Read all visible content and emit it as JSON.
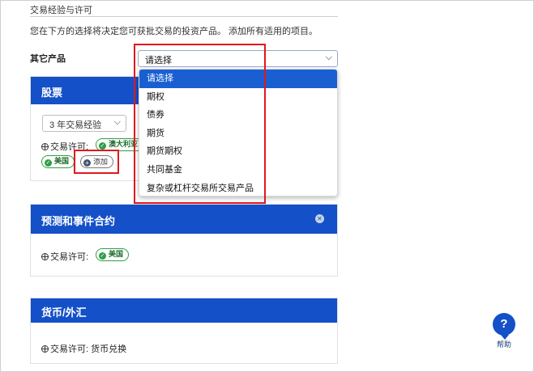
{
  "section": {
    "title": "交易经验与许可",
    "intro": "您在下方的选择将决定您可获批交易的投资产品。 添加所有适用的项目。"
  },
  "other_products": {
    "label": "其它产品",
    "selected": "请选择",
    "options": [
      "请选择",
      "期权",
      "债券",
      "期货",
      "期货期权",
      "共同基金",
      "复杂或杠杆交易所交易产品"
    ]
  },
  "cards": {
    "stocks": {
      "title": "股票",
      "experience": "3 年交易经验",
      "permit_label": "交易许可:",
      "badges": [
        "澳大利亚",
        "美国"
      ],
      "add_label": "添加"
    },
    "prediction": {
      "title": "预测和事件合约",
      "permit_label": "交易许可:",
      "badges": [
        "美国"
      ]
    },
    "forex": {
      "title": "货币/外汇",
      "permit_text": "交易许可: 货币兑换"
    }
  },
  "help": {
    "icon": "?",
    "label": "帮助"
  },
  "colors": {
    "accent": "#1450c8",
    "selected": "#1a5fd1",
    "badge_green": "#2f9e44",
    "highlight": "#e0181c"
  }
}
